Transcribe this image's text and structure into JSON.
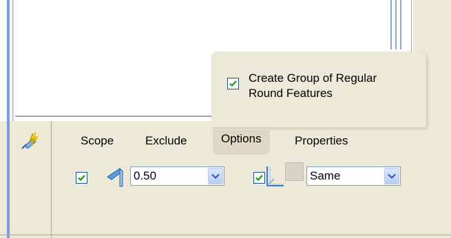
{
  "popup": {
    "checkbox_checked": true,
    "label_line1": "Create Group of Regular",
    "label_line2": "Round Features"
  },
  "tabs": [
    {
      "label": "Scope"
    },
    {
      "label": "Exclude"
    },
    {
      "label": "Options"
    },
    {
      "label": "Properties"
    }
  ],
  "radius": {
    "checkbox_checked": true,
    "value": "0.50"
  },
  "transition": {
    "checkbox_checked": true,
    "value": "Same"
  },
  "icons": {
    "tool": "round-tool-icon",
    "radius": "round-edge-icon",
    "transition": "transition-icon",
    "dropdown": "chevron-down-icon"
  },
  "colors": {
    "check": "#21a121",
    "panel": "#ece9d8",
    "combo_border": "#7f9db9"
  }
}
